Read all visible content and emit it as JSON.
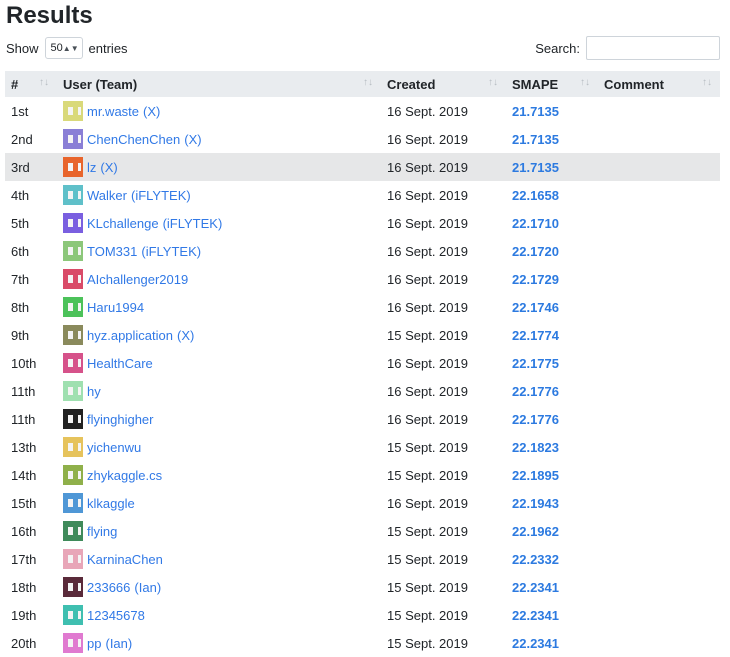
{
  "title": "Results",
  "controls": {
    "show_label": "Show",
    "entries_value": "50",
    "entries_label": "entries",
    "search_label": "Search:"
  },
  "columns": [
    "#",
    "User (Team)",
    "Created",
    "SMAPE",
    "Comment"
  ],
  "rows": [
    {
      "rank": "1st",
      "user": "mr.waste",
      "team": "X",
      "created": "16 Sept. 2019",
      "smape": "21.7135",
      "color": "#d9d97a"
    },
    {
      "rank": "2nd",
      "user": "ChenChenChen",
      "team": "X",
      "created": "16 Sept. 2019",
      "smape": "21.7135",
      "color": "#8a7fd6"
    },
    {
      "rank": "3rd",
      "user": "lz",
      "team": "X",
      "created": "16 Sept. 2019",
      "smape": "21.7135",
      "color": "#e8652c"
    },
    {
      "rank": "4th",
      "user": "Walker",
      "team": "iFLYTEK",
      "created": "16 Sept. 2019",
      "smape": "22.1658",
      "color": "#5fc0c9"
    },
    {
      "rank": "5th",
      "user": "KLchallenge",
      "team": "iFLYTEK",
      "created": "16 Sept. 2019",
      "smape": "22.1710",
      "color": "#7a5fe0"
    },
    {
      "rank": "6th",
      "user": "TOM331",
      "team": "iFLYTEK",
      "created": "16 Sept. 2019",
      "smape": "22.1720",
      "color": "#8cc77a"
    },
    {
      "rank": "7th",
      "user": "AIchallenger2019",
      "team": "",
      "created": "16 Sept. 2019",
      "smape": "22.1729",
      "color": "#d94b68"
    },
    {
      "rank": "8th",
      "user": "Haru1994",
      "team": "",
      "created": "16 Sept. 2019",
      "smape": "22.1746",
      "color": "#4cc25a"
    },
    {
      "rank": "9th",
      "user": "hyz.application",
      "team": "X",
      "created": "15 Sept. 2019",
      "smape": "22.1774",
      "color": "#8a8a5c"
    },
    {
      "rank": "10th",
      "user": "HealthCare",
      "team": "",
      "created": "16 Sept. 2019",
      "smape": "22.1775",
      "color": "#d6528a"
    },
    {
      "rank": "11th",
      "user": "hy",
      "team": "",
      "created": "16 Sept. 2019",
      "smape": "22.1776",
      "color": "#9fe0b0"
    },
    {
      "rank": "11th",
      "user": "flyinghigher",
      "team": "",
      "created": "16 Sept. 2019",
      "smape": "22.1776",
      "color": "#222222"
    },
    {
      "rank": "13th",
      "user": "yichenwu",
      "team": "",
      "created": "15 Sept. 2019",
      "smape": "22.1823",
      "color": "#e6c35c"
    },
    {
      "rank": "14th",
      "user": "zhykaggle.cs",
      "team": "",
      "created": "15 Sept. 2019",
      "smape": "22.1895",
      "color": "#8fb04a"
    },
    {
      "rank": "15th",
      "user": "klkaggle",
      "team": "",
      "created": "16 Sept. 2019",
      "smape": "22.1943",
      "color": "#4f97d6"
    },
    {
      "rank": "16th",
      "user": "flying",
      "team": "",
      "created": "15 Sept. 2019",
      "smape": "22.1962",
      "color": "#3f8a5a"
    },
    {
      "rank": "17th",
      "user": "KarninaChen",
      "team": "",
      "created": "15 Sept. 2019",
      "smape": "22.2332",
      "color": "#e8a6b8"
    },
    {
      "rank": "18th",
      "user": "233666",
      "team": "Ian",
      "created": "15 Sept. 2019",
      "smape": "22.2341",
      "color": "#5a2a3a"
    },
    {
      "rank": "19th",
      "user": "12345678",
      "team": "",
      "created": "15 Sept. 2019",
      "smape": "22.2341",
      "color": "#3fbfb0"
    },
    {
      "rank": "20th",
      "user": "pp",
      "team": "Ian",
      "created": "15 Sept. 2019",
      "smape": "22.2341",
      "color": "#e07ad0"
    }
  ]
}
